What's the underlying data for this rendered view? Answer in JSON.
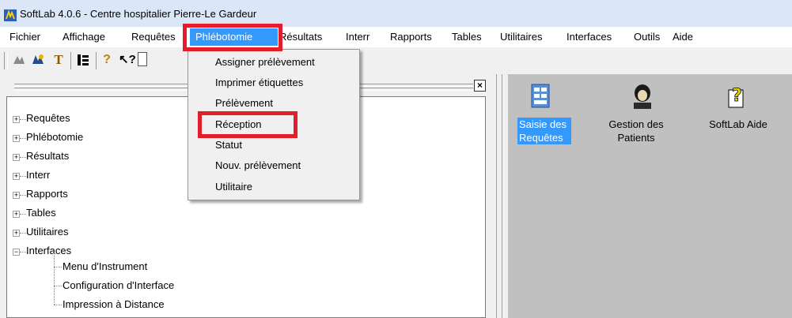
{
  "window": {
    "title": "SoftLab 4.0.6 - Centre hospitalier Pierre-Le Gardeur"
  },
  "menubar": {
    "items": [
      "Fichier",
      "Affichage",
      "Requêtes",
      "Phlébotomie",
      "Résultats",
      "Interr",
      "Rapports",
      "Tables",
      "Utilitaires",
      "Interfaces",
      "Outils",
      "Aide"
    ],
    "active": "Phlébotomie"
  },
  "dropdown": {
    "items": [
      "Assigner prélèvement",
      "Imprimer étiquettes",
      "Prélèvement",
      "Réception",
      "Statut",
      "Nouv. prélèvement",
      "Utilitaire"
    ],
    "highlighted": "Réception"
  },
  "tree": {
    "close_glyph": "×",
    "collapsed_glyph": "+",
    "expanded_glyph": "−",
    "items": [
      "Requêtes",
      "Phlébotomie",
      "Résultats",
      "Interr",
      "Rapports",
      "Tables",
      "Utilitaires",
      "Interfaces"
    ],
    "interfaces_children": [
      "Menu d'Instrument",
      "Configuration d'Interface",
      "Impression à Distance"
    ]
  },
  "shortcuts": [
    {
      "label_line1": "Saisie des",
      "label_line2": "Requêtes",
      "icon": "form-icon",
      "selected": true
    },
    {
      "label_line1": "Gestion des",
      "label_line2": "Patients",
      "icon": "patient-icon",
      "selected": false
    },
    {
      "label_line1": "SoftLab Aide",
      "label_line2": "",
      "icon": "help-icon",
      "selected": false
    }
  ],
  "colors": {
    "selection": "#3399ff",
    "highlight_box": "#e51d2a",
    "workspace": "#c0c0c0"
  }
}
